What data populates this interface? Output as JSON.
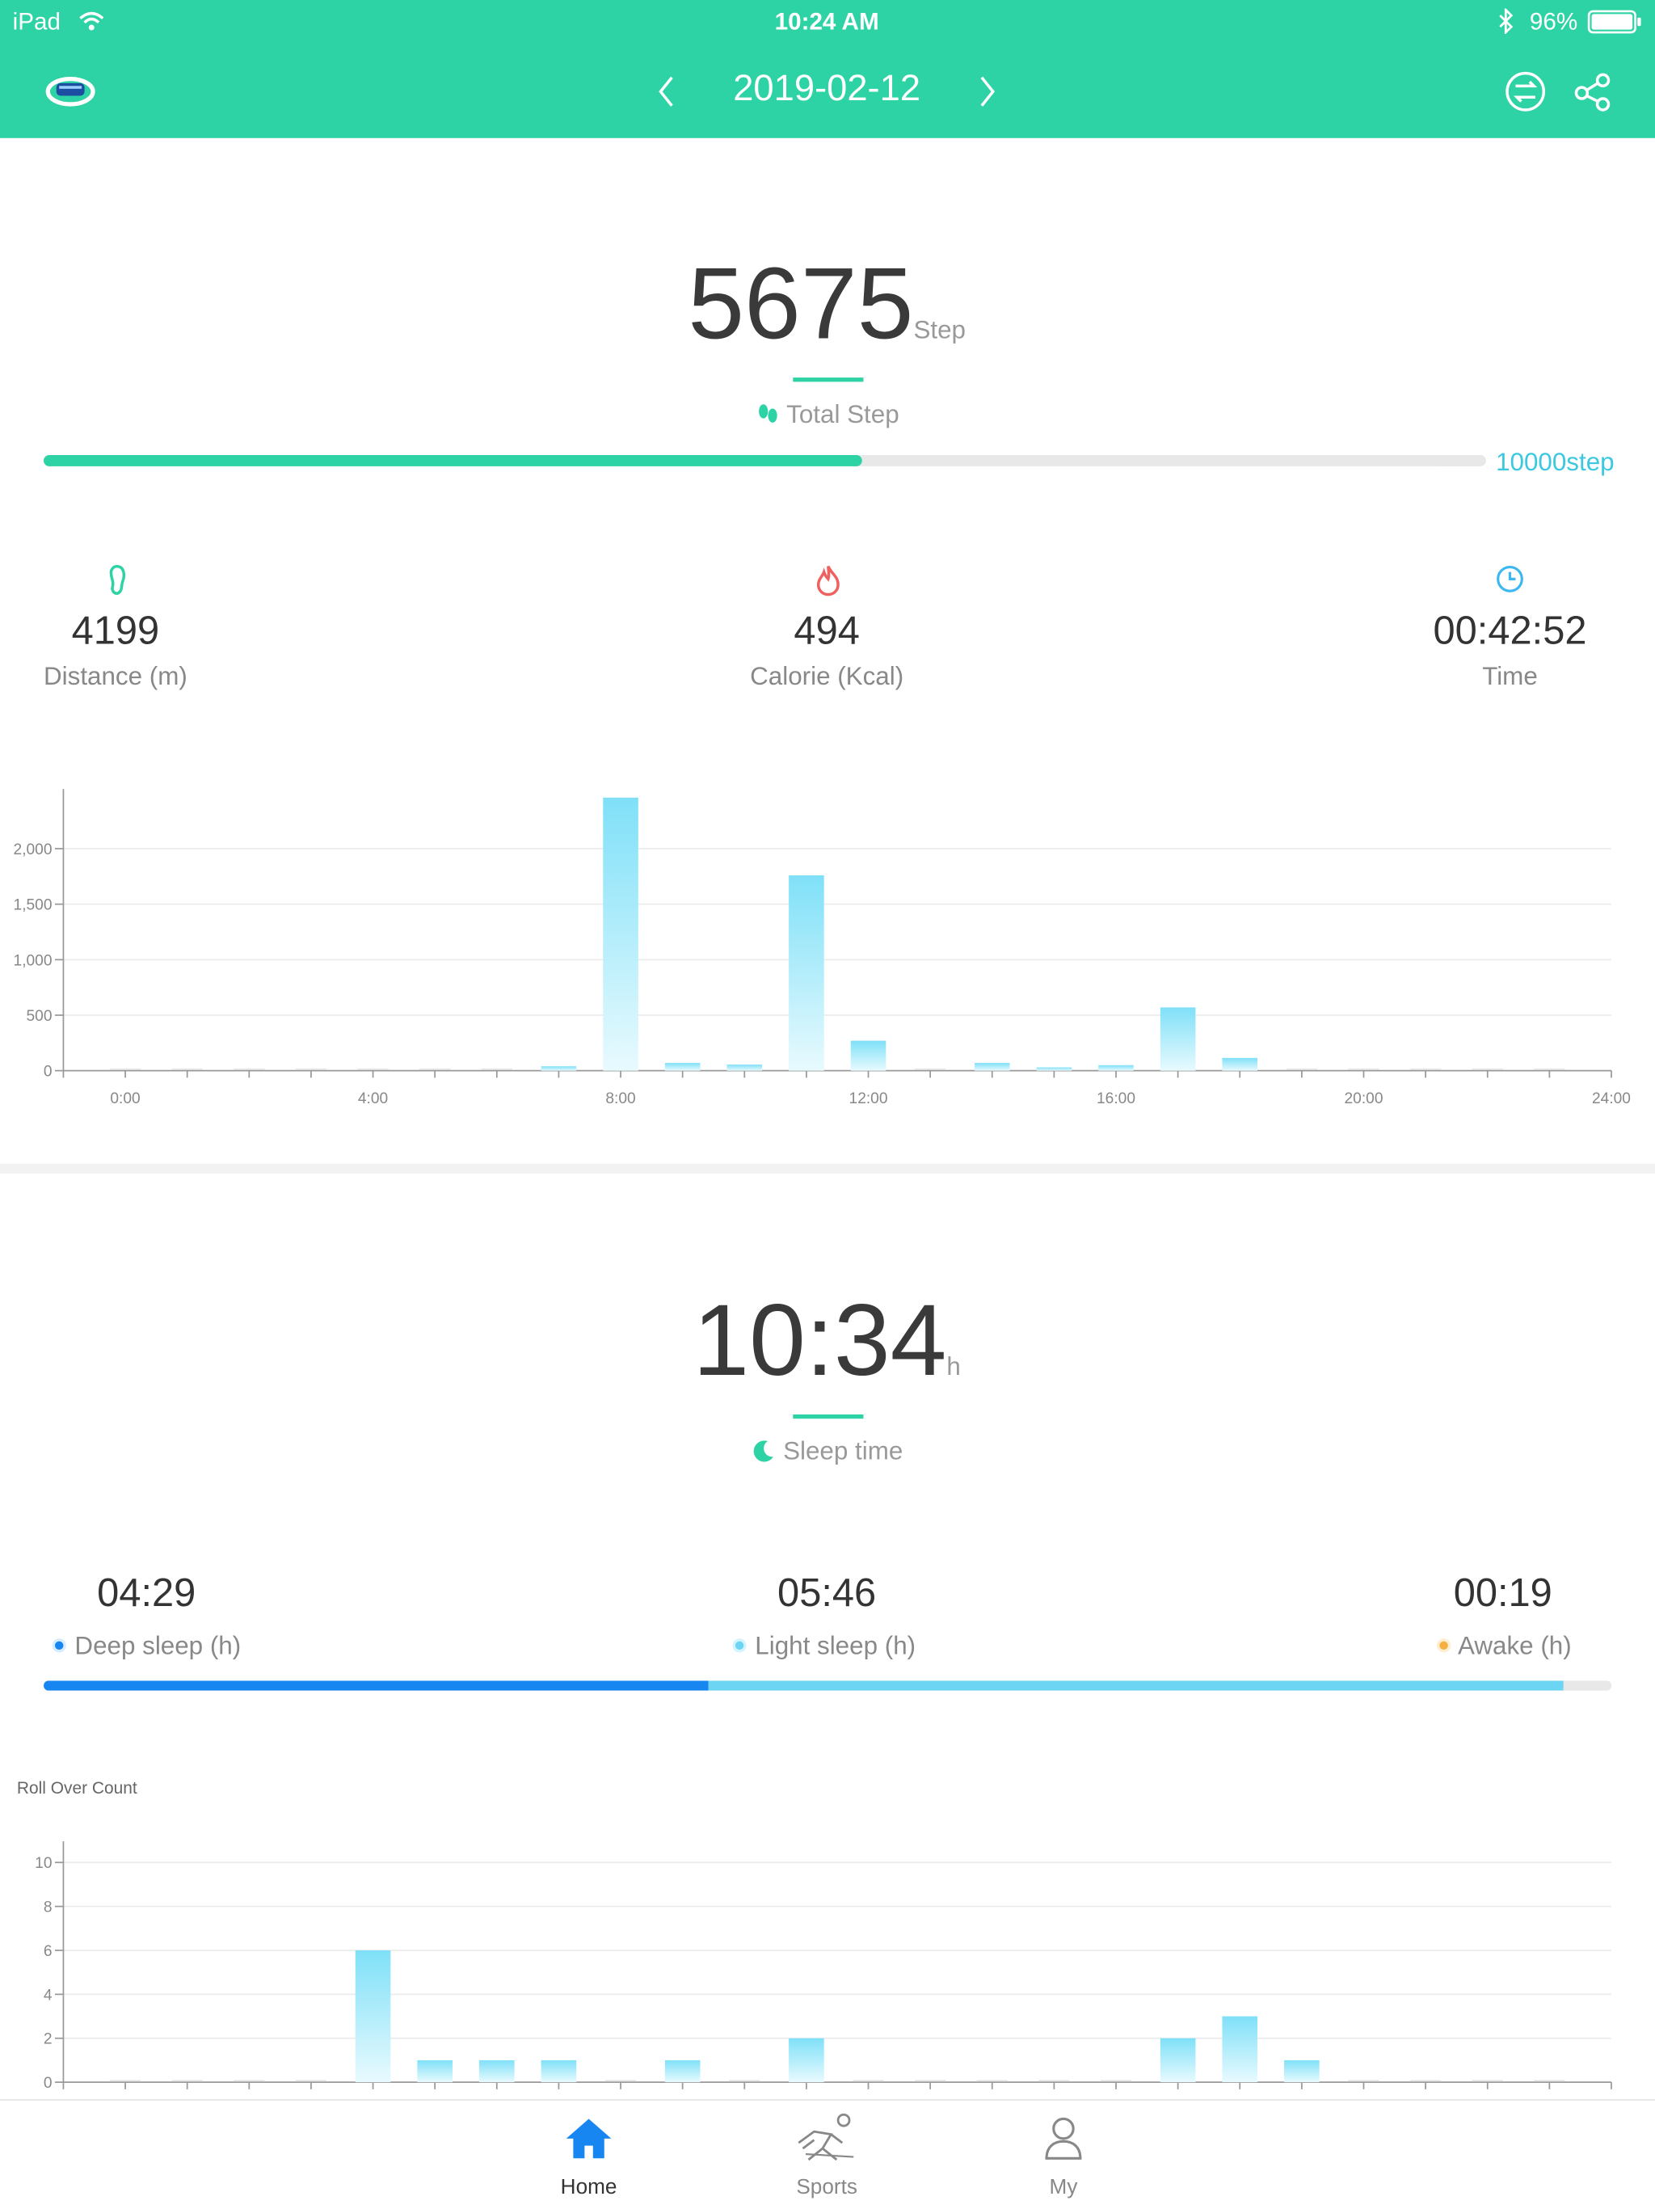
{
  "status_bar": {
    "device": "iPad",
    "time": "10:24 AM",
    "battery": "96%"
  },
  "header": {
    "date": "2019-02-12"
  },
  "steps": {
    "value": "5675",
    "unit": "Step",
    "label": "Total Step",
    "goal": "10000step",
    "progress": 0.5675
  },
  "stats": [
    {
      "value": "4199",
      "label": "Distance (m)",
      "icon": "footprint-icon"
    },
    {
      "value": "494",
      "label": "Calorie (Kcal)",
      "icon": "flame-icon"
    },
    {
      "value": "00:42:52",
      "label": "Time",
      "icon": "clock-icon"
    }
  ],
  "sleep": {
    "value": "10:34",
    "unit": "h",
    "label": "Sleep time",
    "deep": {
      "value": "04:29",
      "label": "Deep sleep (h)",
      "hours": 4.48
    },
    "light": {
      "value": "05:46",
      "label": "Light sleep (h)",
      "hours": 5.77
    },
    "awake": {
      "value": "00:19",
      "label": "Awake (h)",
      "hours": 0.32
    }
  },
  "tabs": [
    {
      "label": "Home",
      "icon": "home-icon",
      "active": true
    },
    {
      "label": "Sports",
      "icon": "running-icon",
      "active": false
    },
    {
      "label": "My",
      "icon": "person-icon",
      "active": false
    }
  ],
  "colors": {
    "header": "#2ed3a5",
    "accent": "#2ed3a5",
    "bar": "#7fe0f8",
    "deep": "#1786f0",
    "light": "#6cd5f3",
    "awake": "#f5b041",
    "tab_active": "#1786f0",
    "goal_text": "#3cc8e0"
  },
  "chart_data": [
    {
      "type": "bar",
      "x_ticks": [
        "0:00",
        "4:00",
        "8:00",
        "12:00",
        "16:00",
        "20:00",
        "24:00"
      ],
      "y_ticks": [
        "0",
        "500",
        "1,000",
        "1,500",
        "2,000"
      ],
      "ylim": [
        0,
        2500
      ],
      "hours": [
        7,
        8,
        9,
        10,
        11,
        12,
        14,
        15,
        16,
        17,
        18
      ],
      "values": [
        40,
        2460,
        70,
        55,
        1760,
        270,
        70,
        30,
        50,
        570,
        115
      ]
    },
    {
      "type": "bar",
      "title": "Roll Over Count",
      "x_ticks": [],
      "y_ticks": [
        "0",
        "2",
        "4",
        "6",
        "8",
        "10"
      ],
      "ylim": [
        0,
        10
      ],
      "hours": [
        4,
        5,
        6,
        7,
        9,
        11,
        17,
        18,
        19
      ],
      "values": [
        6,
        1,
        1,
        1,
        1,
        2,
        2,
        3,
        1
      ]
    }
  ]
}
